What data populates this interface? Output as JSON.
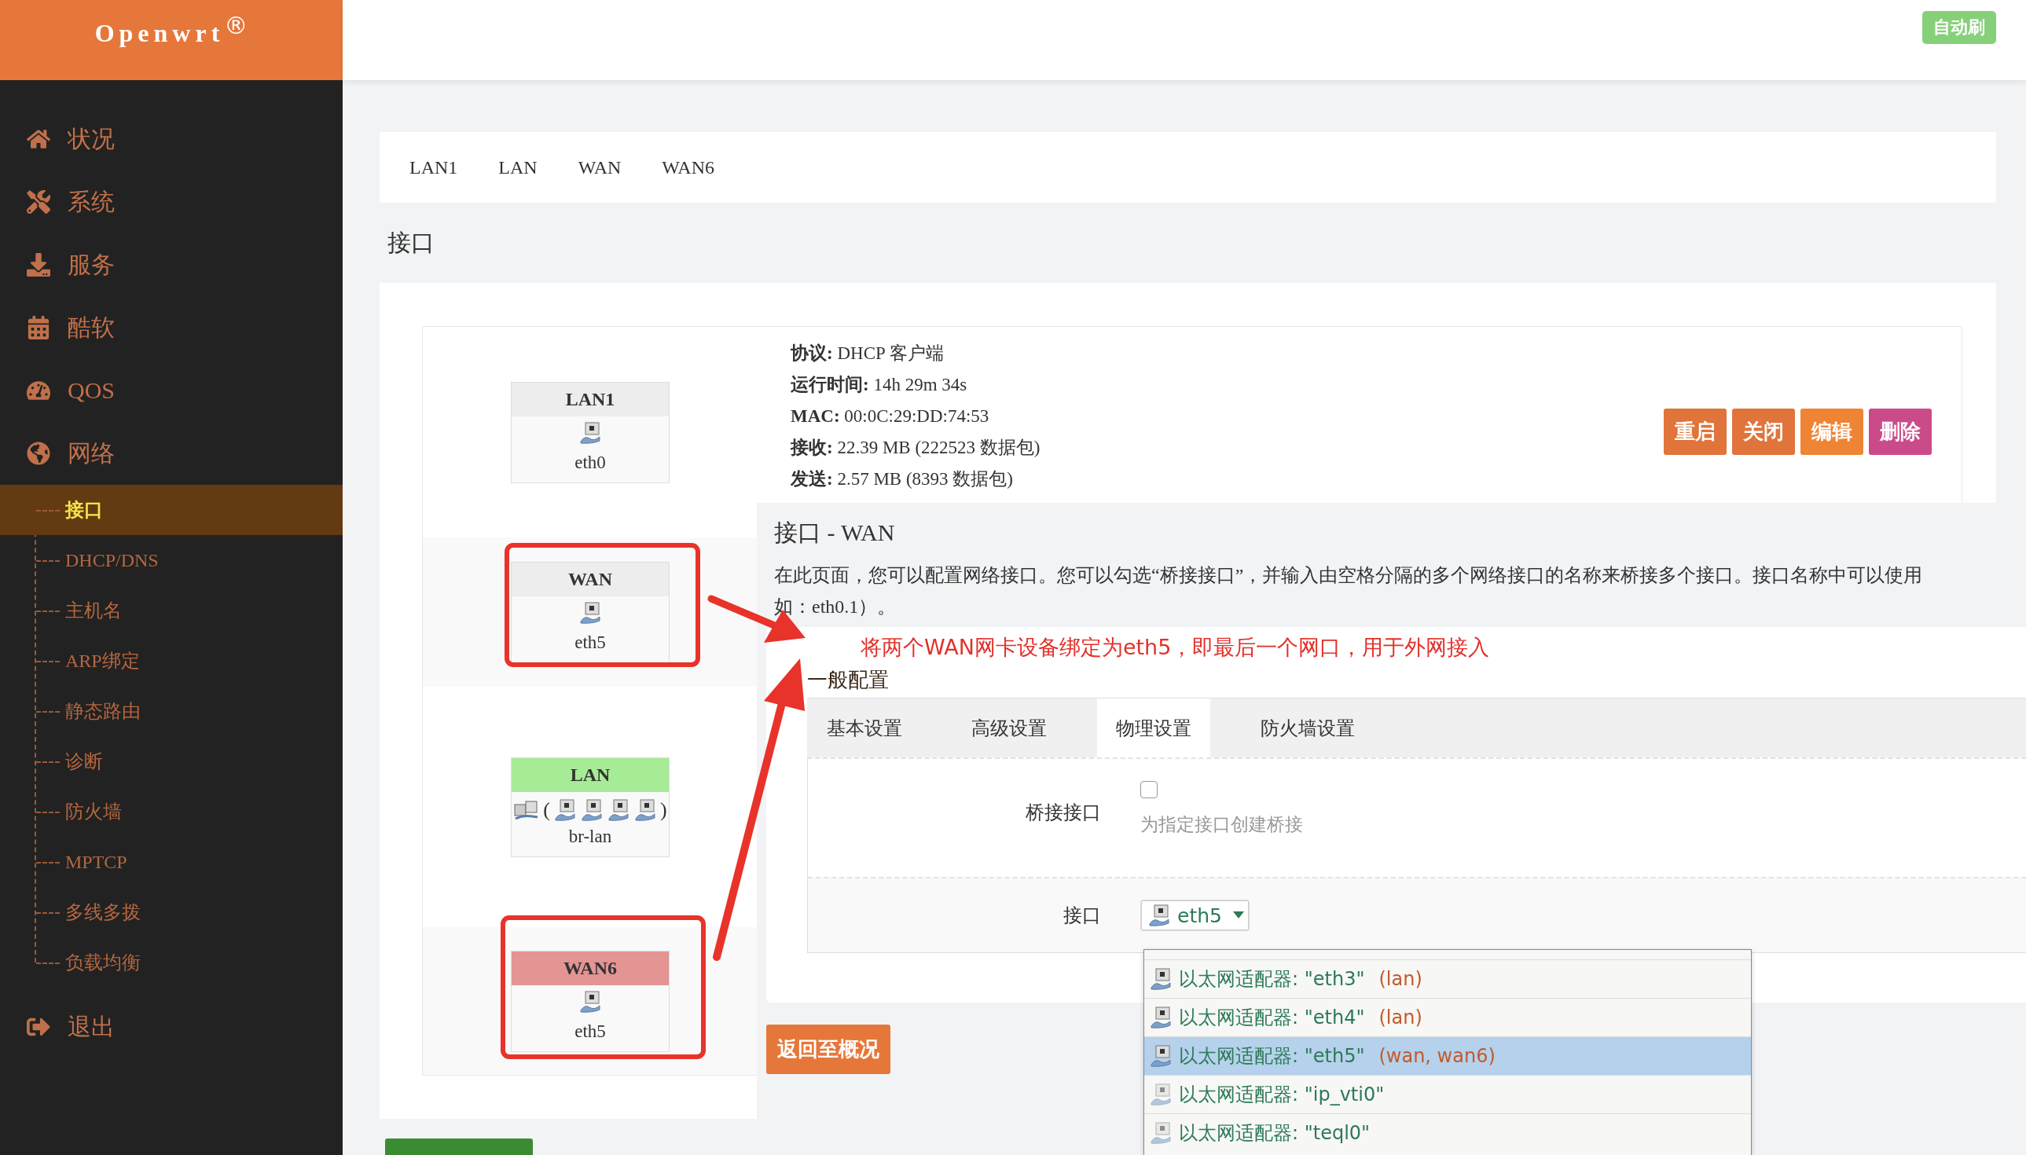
{
  "brand": {
    "name": "Openwrt",
    "mark": "®"
  },
  "header": {
    "badge": "自动刷"
  },
  "menu": [
    {
      "label": "状况"
    },
    {
      "label": "系统"
    },
    {
      "label": "服务"
    },
    {
      "label": "酷软"
    },
    {
      "label": "QOS"
    },
    {
      "label": "网络",
      "children": [
        {
          "label": "接口",
          "selected": true
        },
        {
          "label": "DHCP/DNS",
          "selected": false
        },
        {
          "label": "主机名",
          "selected": false
        },
        {
          "label": "ARP绑定",
          "selected": false
        },
        {
          "label": "静态路由",
          "selected": false
        },
        {
          "label": "诊断",
          "selected": false
        },
        {
          "label": "防火墙",
          "selected": false
        },
        {
          "label": "MPTCP",
          "selected": false
        },
        {
          "label": "多线多拨",
          "selected": false
        },
        {
          "label": "负载均衡",
          "selected": false
        }
      ]
    },
    {
      "label": "退出"
    }
  ],
  "tabs": [
    {
      "label": "LAN1"
    },
    {
      "label": "LAN"
    },
    {
      "label": "WAN"
    },
    {
      "label": "WAN6"
    }
  ],
  "section_title": "接口",
  "interfaces": [
    {
      "name": "LAN1",
      "color": "#ededed",
      "kind": "single",
      "device": "eth0",
      "highlighted": false
    },
    {
      "name": "WAN",
      "color": "#ededed",
      "kind": "single",
      "device": "eth5",
      "highlighted": true
    },
    {
      "name": "LAN",
      "color": "#a6eb95",
      "kind": "bridge",
      "ports_open": "(",
      "ports": [
        {
          "kind": "adapter"
        },
        {
          "kind": "adapter"
        },
        {
          "kind": "adapter"
        },
        {
          "kind": "adapter"
        }
      ],
      "ports_close": ")",
      "device": "br-lan",
      "highlighted": false
    },
    {
      "name": "WAN6",
      "color": "#e39493",
      "kind": "single",
      "device": "eth5",
      "highlighted": true
    }
  ],
  "status": [
    {
      "label": "协议:",
      "value": "DHCP 客户端"
    },
    {
      "label": "运行时间:",
      "value": "14h 29m 34s"
    },
    {
      "label": "MAC:",
      "value": "00:0C:29:DD:74:53"
    },
    {
      "label": "接收:",
      "value": "22.39 MB (222523 数据包)"
    },
    {
      "label": "发送:",
      "value": "2.57 MB (8393 数据包)"
    }
  ],
  "actions": [
    {
      "label": "重启",
      "color": "#e0743a"
    },
    {
      "label": "关闭",
      "color": "#e0743a"
    },
    {
      "label": "编辑",
      "color": "#ef8434"
    },
    {
      "label": "删除",
      "color": "#cb4b8a"
    }
  ],
  "dialog": {
    "title": "接口 - WAN",
    "description": [
      "在此页面，您可以配置网络接口。您可以勾选“桥接接口”，并输入由空格分隔的多个网络接口的名称来桥接多个接口。接口名称中可以使用",
      "如：eth0.1）。"
    ],
    "annotation": "将两个WAN网卡设备绑定为eth5，即最后一个网口，用于外网接入",
    "section": "一般配置",
    "tabs": [
      {
        "label": "基本设置",
        "selected": false
      },
      {
        "label": "高级设置",
        "selected": false
      },
      {
        "label": "物理设置",
        "selected": true
      },
      {
        "label": "防火墙设置",
        "selected": false
      }
    ],
    "fields": [
      {
        "kind": "checkbox",
        "label": "桥接接口",
        "checked": false,
        "help": "为指定接口创建桥接"
      },
      {
        "kind": "select",
        "label": "接口",
        "value": "eth5",
        "expanded": true
      }
    ],
    "options": [
      {
        "device": "以太网适配器: \"eth3\"",
        "networks": "(lan)",
        "selected": false,
        "disabled": false
      },
      {
        "device": "以太网适配器: \"eth4\"",
        "networks": "(lan)",
        "selected": false,
        "disabled": false
      },
      {
        "device": "以太网适配器: \"eth5\"",
        "networks": "(wan, wan6)",
        "selected": true,
        "disabled": false
      },
      {
        "device": "以太网适配器: \"ip_vti0\"",
        "selected": false,
        "disabled": true
      },
      {
        "device": "以太网适配器: \"teql0\"",
        "selected": false,
        "disabled": true
      }
    ],
    "back_button": "返回至概况"
  }
}
